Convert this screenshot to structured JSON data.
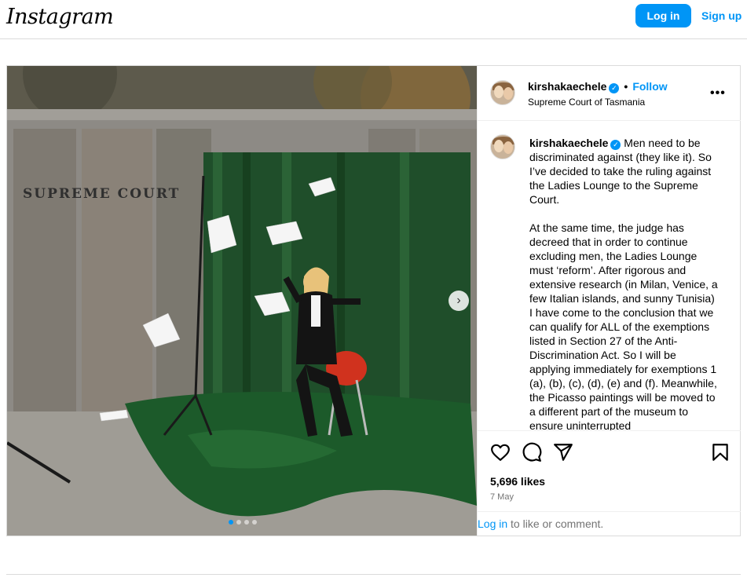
{
  "brand": {
    "logo_text": "Instagram"
  },
  "auth": {
    "login_label": "Log in",
    "signup_label": "Sign up"
  },
  "post": {
    "username": "kirshakaechele",
    "verified_mark": "✓",
    "separator": "•",
    "follow_label": "Follow",
    "location": "Supreme Court of Tasmania",
    "more_label": "•••",
    "image": {
      "icon": "photo",
      "sign_text": "SUPREME COURT",
      "carousel_count": 4,
      "carousel_active": 1,
      "next_arrow": "›"
    },
    "caption": {
      "username": "kirshakaechele",
      "paragraph1": "Men need to be discriminated against (they like it). So I’ve decided to take the ruling against the Ladies Lounge to the Supreme Court.",
      "paragraph2": "At the same time, the judge has decreed that in order to continue excluding men, the Ladies Lounge must ‘reform’. After rigorous and extensive research (in Milan, Venice, a few Italian islands, and sunny Tunisia) I have come to the conclusion that we can qualify for ALL of the exemptions listed in Section 27 of the Anti-Discrimination Act. So I will be applying immediately for exemptions 1 (a), (b), (c), (d), (e) and (f). Meanwhile, the Picasso paintings will be moved to a different part of the museum to ensure uninterrupted"
    },
    "actions": {
      "like_icon": "heart-icon",
      "comment_icon": "comment-icon",
      "share_icon": "share-icon",
      "save_icon": "bookmark-icon"
    },
    "likes": "5,696 likes",
    "date": "7 May",
    "comment_prompt": {
      "login_label": "Log in",
      "rest": " to like or comment."
    }
  },
  "colors": {
    "accent": "#0095f6",
    "border": "#dbdbdb",
    "muted": "#737373"
  }
}
